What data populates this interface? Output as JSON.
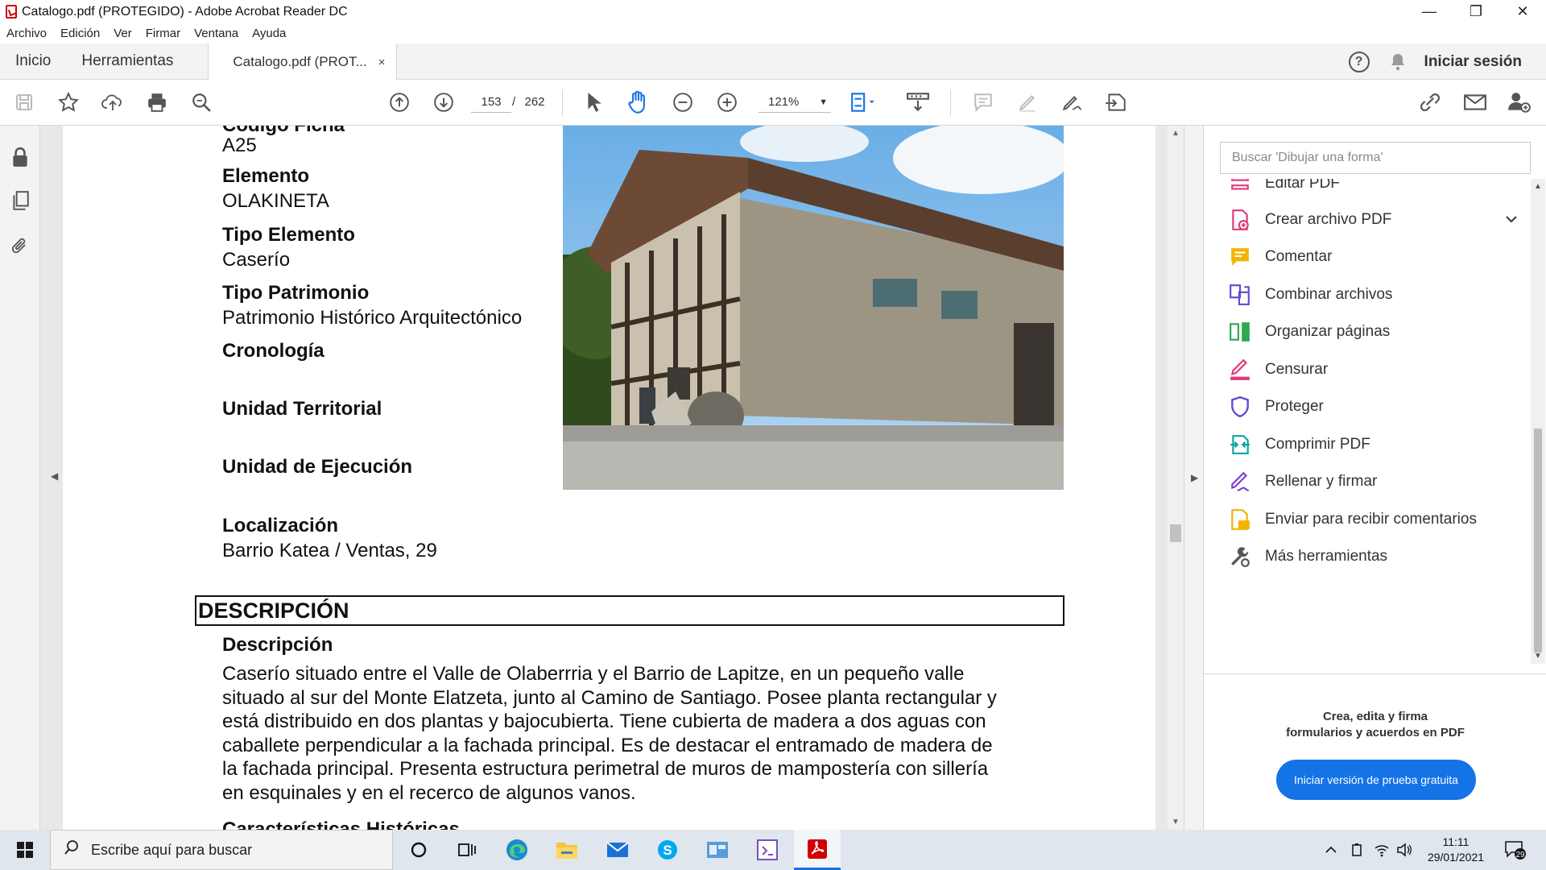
{
  "window": {
    "title": "Catalogo.pdf (PROTEGIDO) - Adobe Acrobat Reader DC",
    "controls": [
      "minimize",
      "restore",
      "close"
    ]
  },
  "menu": [
    "Archivo",
    "Edición",
    "Ver",
    "Firmar",
    "Ventana",
    "Ayuda"
  ],
  "tabs": {
    "home": "Inicio",
    "tools": "Herramientas",
    "document": "Catalogo.pdf (PROT...",
    "close": "×",
    "signin": "Iniciar sesión",
    "help": "?"
  },
  "toolbar": {
    "page_current": "153",
    "page_sep": "/",
    "page_total": "262",
    "zoom": "121%"
  },
  "document": {
    "partial_top": "Código Ficha",
    "code_value": "A25",
    "fields": [
      {
        "label": "Elemento",
        "value": "OLAKINETA"
      },
      {
        "label": "Tipo Elemento",
        "value": "Caserío"
      },
      {
        "label": "Tipo Patrimonio",
        "value": "Patrimonio Histórico Arquitectónico"
      },
      {
        "label": "Cronología",
        "value": ""
      },
      {
        "label": "Unidad Territorial",
        "value": ""
      },
      {
        "label": "Unidad de Ejecución",
        "value": ""
      },
      {
        "label": "Localización",
        "value": "Barrio Katea / Ventas, 29"
      }
    ],
    "section_title": "DESCRIPCIÓN",
    "desc_label": "Descripción",
    "desc_lines": [
      "Caserío situado entre el Valle de Olaberrria y el Barrio de Lapitze, en un pequeño valle",
      "situado al sur del Monte Elatzeta, junto al Camino de Santiago. Posee planta rectangular y",
      "está distribuido en dos plantas y bajocubierta. Tiene cubierta de madera a dos aguas con",
      "caballete perpendicular a la fachada principal. Es de destacar el entramado de madera de",
      "la fachada principal. Presenta estructura perimetral de muros de mampostería con sillería",
      "en esquinales y en el recerco de algunos vanos."
    ],
    "next_label": "Características Históricas"
  },
  "right_panel": {
    "search_placeholder": "Buscar 'Dibujar una forma'",
    "tools": [
      {
        "label": "Editar PDF",
        "icon": "edit-pdf-icon",
        "color": "#e0397a"
      },
      {
        "label": "Crear archivo PDF",
        "icon": "create-pdf-icon",
        "color": "#e0397a"
      },
      {
        "label": "Comentar",
        "icon": "comment-icon",
        "color": "#f2b400"
      },
      {
        "label": "Combinar archivos",
        "icon": "combine-icon",
        "color": "#5b4ed1"
      },
      {
        "label": "Organizar páginas",
        "icon": "organize-icon",
        "color": "#2fa84f"
      },
      {
        "label": "Censurar",
        "icon": "redact-icon",
        "color": "#e0397a"
      },
      {
        "label": "Proteger",
        "icon": "protect-icon",
        "color": "#5b4ed1"
      },
      {
        "label": "Comprimir PDF",
        "icon": "compress-icon",
        "color": "#12a3a3"
      },
      {
        "label": "Rellenar y firmar",
        "icon": "fill-sign-icon",
        "color": "#7b3fd1"
      },
      {
        "label": "Enviar para recibir comentarios",
        "icon": "send-review-icon",
        "color": "#f2b400"
      },
      {
        "label": "Más herramientas",
        "icon": "more-tools-icon",
        "color": "#555555"
      }
    ],
    "promo_line1": "Crea, edita y firma",
    "promo_line2": "formularios y acuerdos en PDF",
    "trial_button": "Iniciar versión de prueba gratuita"
  },
  "taskbar": {
    "search_placeholder": "Escribe aquí para buscar",
    "time": "11:11",
    "date": "29/01/2021",
    "notifications": "29"
  },
  "colors": {
    "accent": "#1473e6",
    "acrobat_red": "#d10000"
  }
}
